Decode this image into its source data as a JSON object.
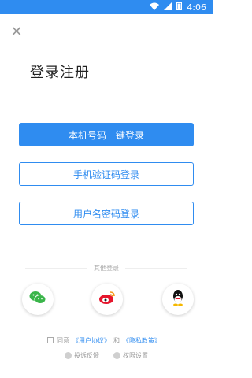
{
  "status_bar": {
    "time": "4:06",
    "icons": [
      "wifi-icon",
      "cell-signal-icon",
      "battery-icon"
    ]
  },
  "header": {
    "close_icon": "close-icon",
    "title": "登录注册"
  },
  "login_buttons": {
    "one_click": "本机号码一键登录",
    "sms_code": "手机验证码登录",
    "password": "用户名密码登录"
  },
  "other_login": {
    "label": "其他登录",
    "providers": [
      {
        "name": "wechat",
        "icon": "wechat-icon",
        "color": "#3ab54a"
      },
      {
        "name": "weibo",
        "icon": "weibo-icon",
        "color": "#e6162d"
      },
      {
        "name": "qq",
        "icon": "qq-icon",
        "color": "#111111"
      }
    ]
  },
  "agreement": {
    "prefix": "同意",
    "user_agreement": "《用户协议》",
    "and": "和",
    "privacy_policy": "《隐私政策》"
  },
  "footer": {
    "feedback": "投诉反馈",
    "permissions": "权限设置"
  },
  "colors": {
    "accent": "#2f8cf0",
    "text_muted": "#999999"
  }
}
